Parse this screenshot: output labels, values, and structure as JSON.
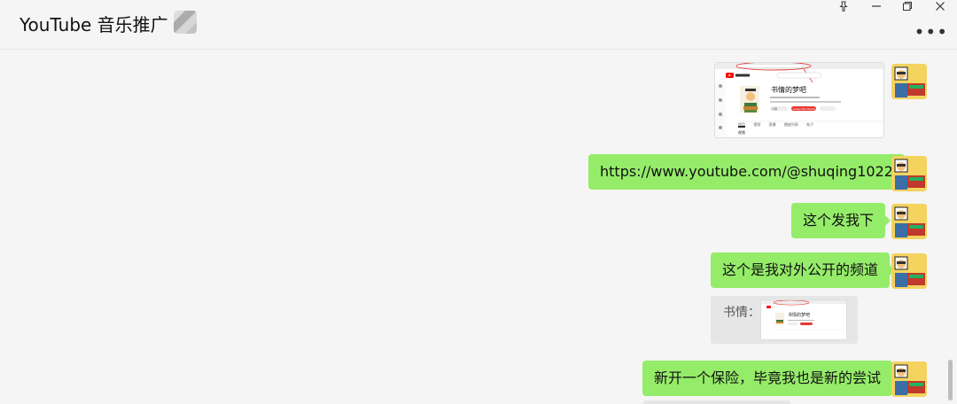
{
  "header": {
    "title": "YouTube 音乐推广",
    "icons": [
      "pin-icon",
      "minimize-icon",
      "maximize-icon",
      "close-icon",
      "more-icon"
    ]
  },
  "messages": [
    {
      "type": "image",
      "from": "me"
    },
    {
      "type": "text",
      "from": "me",
      "text": "https://www.youtube.com/@shuqing1022"
    },
    {
      "type": "text",
      "from": "me",
      "text": "这个发我下"
    },
    {
      "type": "text",
      "from": "me",
      "text": "这个是我对外公开的频道"
    },
    {
      "type": "quote",
      "from": "me",
      "label": "书情："
    },
    {
      "type": "text",
      "from": "me",
      "text": "新开一个保险，毕竟我也是新的尝试"
    }
  ],
  "preview": {
    "channel_name": "书情的梦吧",
    "channel_name_small": "书情的梦吧",
    "tabs": [
      "首页",
      "视频",
      "直播",
      "播放列表",
      "帖子"
    ],
    "section": "视频",
    "subscribe": "订阅",
    "join": "Subscribe Studio"
  },
  "colors": {
    "background": "#f5f5f5",
    "bubble_green": "#95ec69",
    "quote_gray": "#e6e6e6"
  }
}
